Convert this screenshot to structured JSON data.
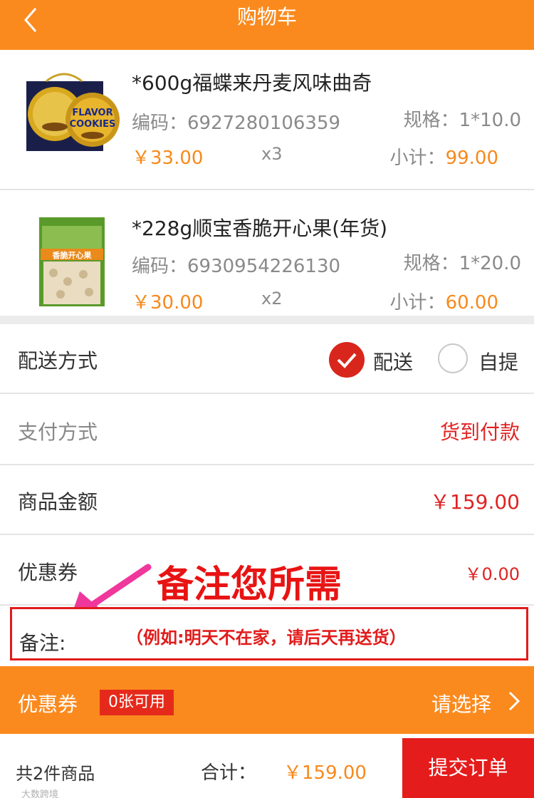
{
  "header": {
    "title": "购物车",
    "back_icon": "chevron-left-icon"
  },
  "items": [
    {
      "name": "*600g福蝶来丹麦风味曲奇",
      "code": "编码：6927280106359",
      "spec": "规格：1*10.0",
      "price": "￥33.00",
      "qty": "x3",
      "subtotal_label": "小计：",
      "subtotal": "99.00",
      "image_text": [
        "FLAVOR",
        "COOKIES"
      ]
    },
    {
      "name": "*228g顺宝香脆开心果(年货)",
      "code": "编码：6930954226130",
      "spec": "规格：1*20.0",
      "price": "￥30.00",
      "qty": "x2",
      "subtotal_label": "小计：",
      "subtotal": "60.00",
      "image_text": "香脆开心果"
    }
  ],
  "delivery": {
    "label": "配送方式",
    "option_delivery": "配送",
    "option_pickup": "自提",
    "selected": "配送"
  },
  "payment": {
    "label": "支付方式",
    "value": "货到付款"
  },
  "amount": {
    "label": "商品金额",
    "value": "￥159.00"
  },
  "coupon_row": {
    "label": "优惠券",
    "value": "￥0.00"
  },
  "annotation": {
    "text": "备注您所需"
  },
  "note": {
    "label": "备注:",
    "placeholder": "（例如:明天不在家，请后天再送货）"
  },
  "coupon_bar": {
    "label": "优惠券",
    "badge": "0张可用",
    "select": "请选择"
  },
  "footer": {
    "count": "共2件商品",
    "total_label": "合计：",
    "total": "￥159.00",
    "submit": "提交订单",
    "watermark": "大数跨境"
  },
  "colors": {
    "accent": "#fb8a1e",
    "price": "#f7891c",
    "red": "#e51c1c"
  }
}
